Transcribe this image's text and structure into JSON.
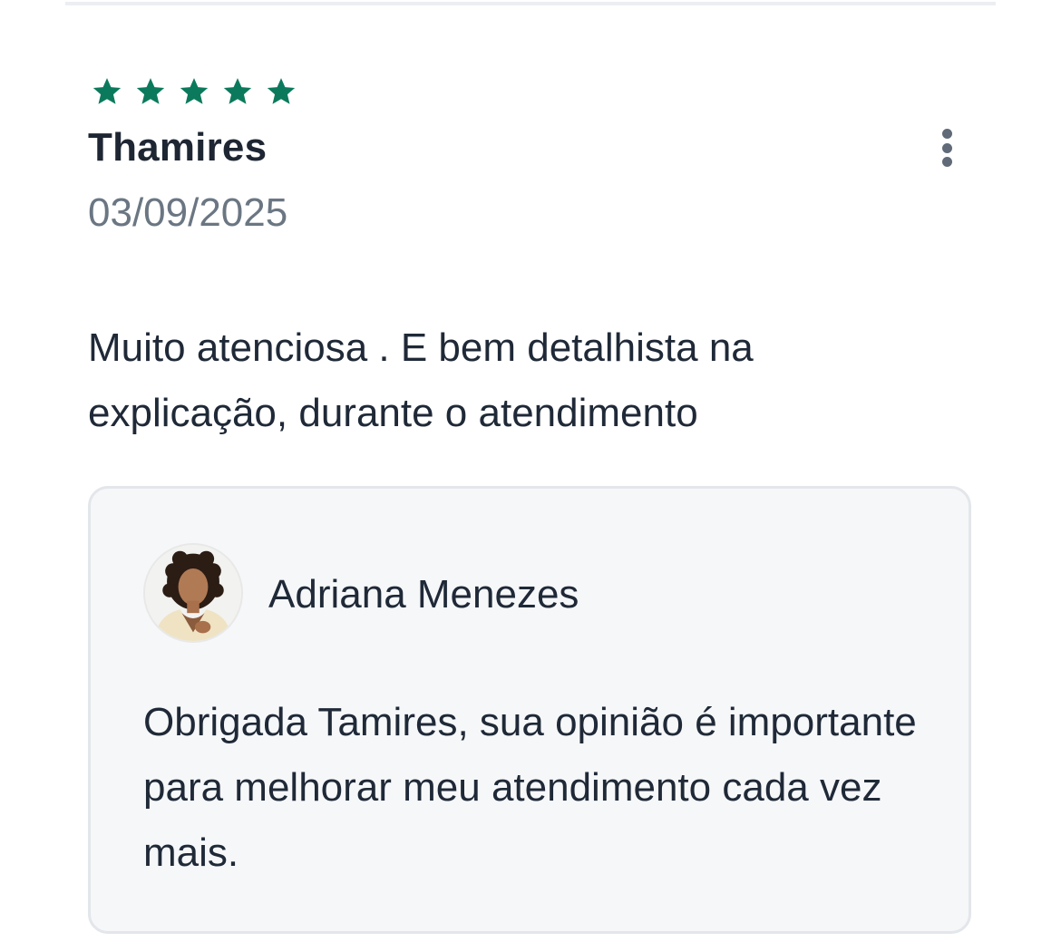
{
  "review": {
    "rating": 5,
    "max_rating": 5,
    "star_color": "#0b7a5c",
    "reviewer_name": "Thamires",
    "date": "03/09/2025",
    "text": "Muito atenciosa . E bem detalhista na explicação, durante o atendimento",
    "more_icon": "more-vertical-icon"
  },
  "reply": {
    "author_name": "Adriana Menezes",
    "text": "Obrigada Tamires, sua opinião é importante para melhorar meu atendimento cada vez mais."
  }
}
